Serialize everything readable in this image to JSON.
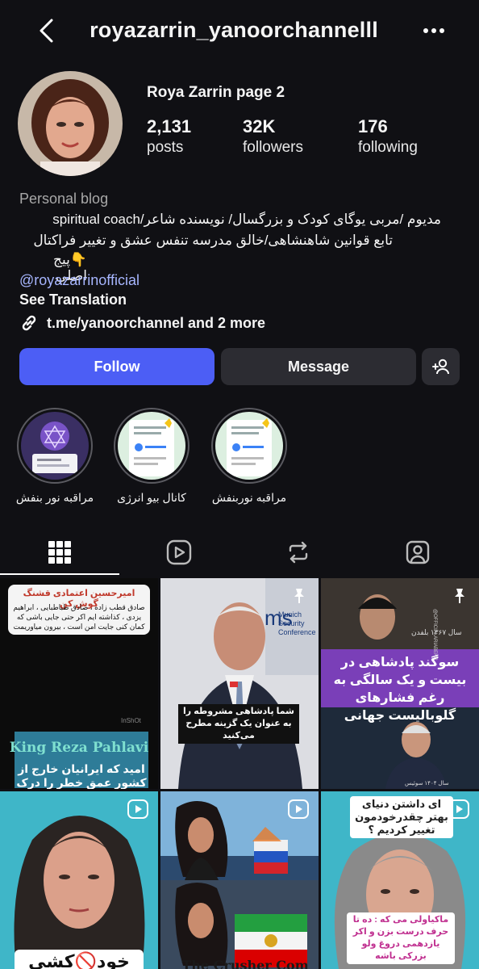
{
  "header": {
    "username": "royazarrin_yanoorchannelll",
    "back_icon": "chevron-left-icon",
    "more_icon": "more-horizontal-icon"
  },
  "profile": {
    "display_name": "Roya Zarrin page 2",
    "stats": {
      "posts": {
        "value": "2,131",
        "label": "posts"
      },
      "followers": {
        "value": "32K",
        "label": "followers"
      },
      "following": {
        "value": "176",
        "label": "following"
      }
    },
    "category": "Personal blog",
    "bio_line1": "مدیوم /مربی یوگای کودک و بزرگسال/ نویسنده شاعر/spiritual coach",
    "bio_line2": "تابع قوانین شاهنشاهی/خالق مدرسه تنفس عشق و تغییر فراکتال",
    "bio_line3": "👇پیج اصلي",
    "mention": "@royazarrinofficial",
    "see_translation": "See Translation",
    "link": "t.me/yanoorchannel and 2 more"
  },
  "actions": {
    "follow": "Follow",
    "message": "Message",
    "add_user_icon": "add-user-icon"
  },
  "highlights": [
    {
      "label": "مراقبه نور بنفش"
    },
    {
      "label": "کانال بیو انرژی"
    },
    {
      "label": "مراقبه نوربنفش"
    }
  ],
  "tabs": [
    {
      "name": "grid",
      "icon": "grid-icon",
      "active": true
    },
    {
      "name": "reels",
      "icon": "reels-icon",
      "active": false
    },
    {
      "name": "reposts",
      "icon": "repost-icon",
      "active": false
    },
    {
      "name": "tagged",
      "icon": "tagged-icon",
      "active": false
    }
  ],
  "posts": {
    "p1": {
      "title": "امیرحسین اعتمادی قشنگ گوش کن",
      "body": "صادق قطب زاده ، صادق طباطبایی ، ابراهیم یزدی ، کذاشته ایم اکر حتی جایی باشی که کمان کنی جایت امن است ، بیرون میاوریمت",
      "watermark": "InShOt",
      "name": "King Reza Pahlavi",
      "caption": "امید که ایرانیان خارج از کشور عمق خطر را درک کنند"
    },
    "p2": {
      "caption": "شما پادشاهی مشروطه را به عنوان یک گزینه مطرح می‌کنید",
      "backdrop": "Munich Security Conference",
      "backdrop_short": "ms"
    },
    "p3": {
      "handle": "@OFFICIALARIABEHR",
      "year_top": "سال ۱۳۶۷ بلفدن",
      "caption": "سوگند پادشاهی در بیست و یک سالگی به رغم فشارهای گلوبالیست جهانی",
      "year_bottom": "سال ۱۴۰۴ سوئیس"
    },
    "p4": {
      "caption": "خود🚫کشی"
    },
    "p5": {
      "caption": "The Crusher Com"
    },
    "p6": {
      "caption_top": "ای داشتن دنیای بهتر چقدرخودمون تغییر کردیم ؟",
      "caption_bottom": "ماکیاولی می که : ده تا حرف درست بزن و اکر یازدهمی دروغ ولو بزرکی باشه"
    }
  },
  "colors": {
    "background": "#101014",
    "follow_button": "#4c5ef5",
    "secondary_button": "#2c2c32",
    "mention": "#a7b6ff",
    "muted": "#a8a8a8"
  }
}
